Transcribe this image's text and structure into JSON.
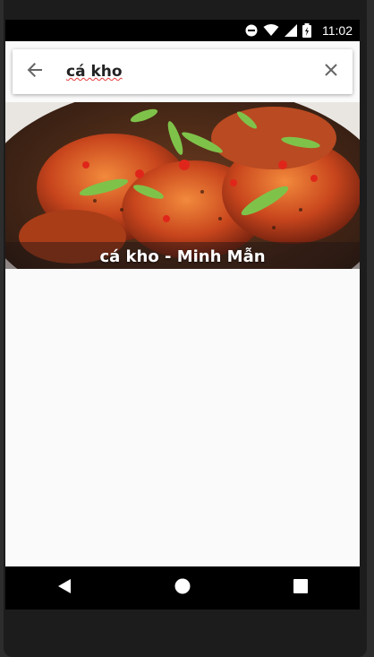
{
  "status_bar": {
    "time": "11:02",
    "icons": [
      "do-not-disturb-icon",
      "wifi-icon",
      "signal-icon",
      "battery-charging-icon"
    ]
  },
  "search": {
    "query": "cá kho",
    "back_icon": "arrow-left-icon",
    "clear_icon": "close-icon"
  },
  "results": [
    {
      "caption": "cá kho - Minh Mẫn",
      "image": "braised-fish-photo"
    }
  ],
  "nav_bar": {
    "buttons": [
      "back-triangle-icon",
      "home-circle-icon",
      "recents-square-icon"
    ]
  },
  "colors": {
    "status_bar": "#000000",
    "screen_bg": "#fafafa",
    "nav_bar": "#000000",
    "spell_underline": "#e53935"
  }
}
